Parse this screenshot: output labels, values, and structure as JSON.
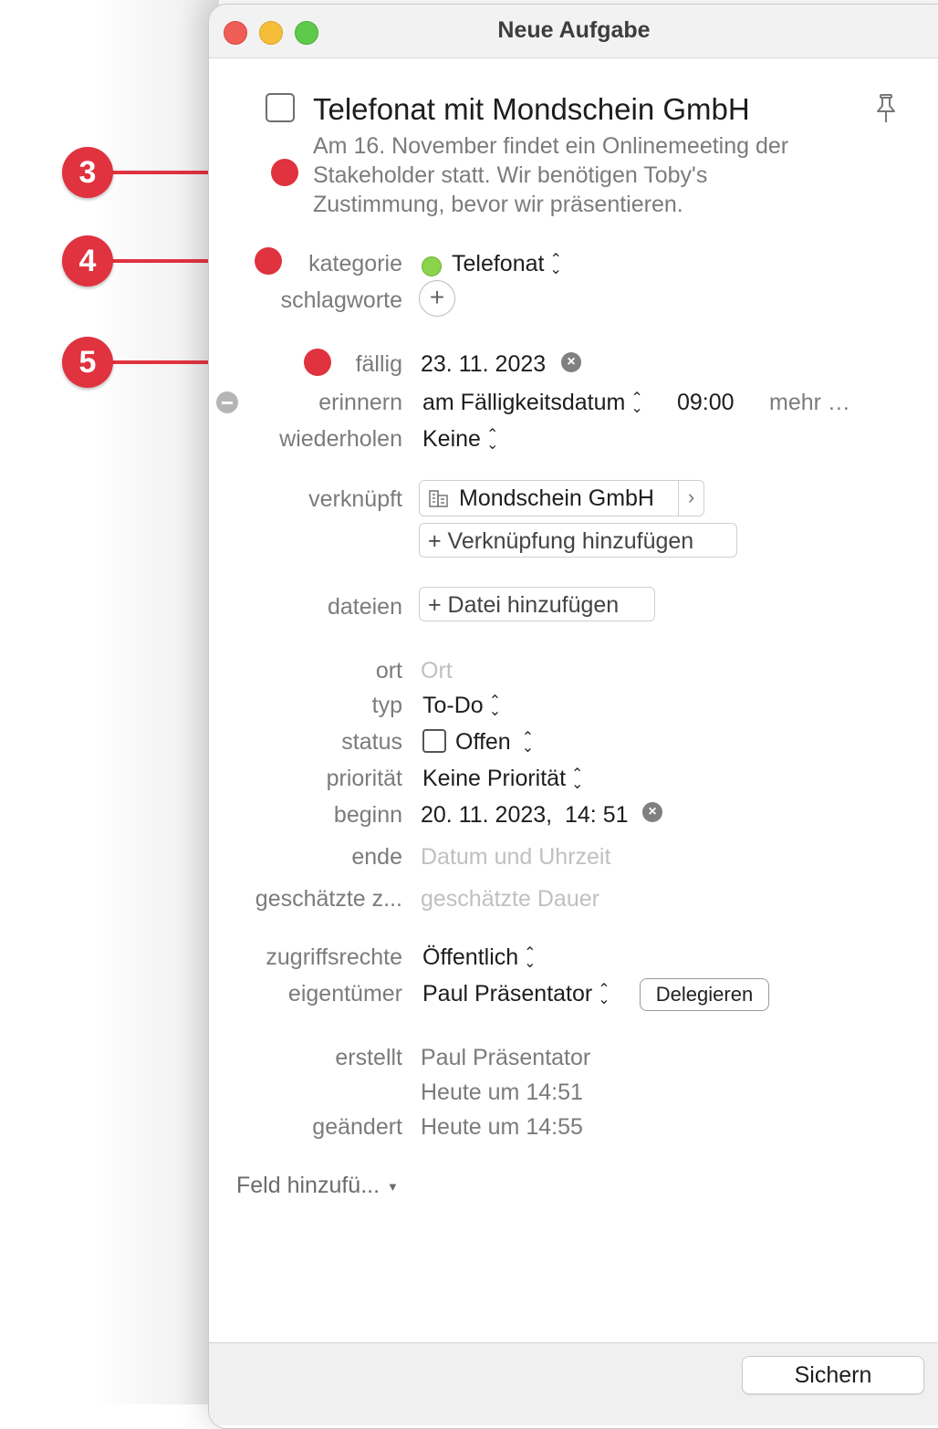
{
  "window": {
    "title": "Neue Aufgabe"
  },
  "task": {
    "title": "Telefonat mit Mondschein GmbH",
    "description_lines": [
      "Am 16. November findet ein Onlinemeeting der",
      "Stakeholder statt. Wir benötigen Toby's",
      "Zustimmung, bevor wir präsentieren."
    ]
  },
  "fields": {
    "kategorie": {
      "label": "kategorie",
      "value": "Telefonat",
      "dot_color": "#8ad34a"
    },
    "schlagworte": {
      "label": "schlagworte"
    },
    "faellig": {
      "label": "fällig",
      "value": "23. 11. 2023"
    },
    "erinnern": {
      "label": "erinnern",
      "value": "am Fälligkeitsdatum",
      "time": "09:00",
      "more": "mehr …"
    },
    "wiederholen": {
      "label": "wiederholen",
      "value": "Keine"
    },
    "verknuepft": {
      "label": "verknüpft",
      "link": "Mondschein GmbH",
      "add": "+ Verknüpfung hinzufügen"
    },
    "dateien": {
      "label": "dateien",
      "add": "+ Datei hinzufügen"
    },
    "ort": {
      "label": "ort",
      "placeholder": "Ort"
    },
    "typ": {
      "label": "typ",
      "value": "To-Do"
    },
    "status": {
      "label": "status",
      "value": "Offen"
    },
    "prioritaet": {
      "label": "priorität",
      "value": "Keine Priorität"
    },
    "beginn": {
      "label": "beginn",
      "value": "20. 11. 2023,  14: 51"
    },
    "ende": {
      "label": "ende",
      "placeholder": "Datum und Uhrzeit"
    },
    "dauer": {
      "label": "geschätzte z...",
      "placeholder": "geschätzte Dauer"
    },
    "zugriffsrechte": {
      "label": "zugriffsrechte",
      "value": "Öffentlich"
    },
    "eigentuemer": {
      "label": "eigentümer",
      "value": "Paul Präsentator",
      "button": "Delegieren"
    },
    "erstellt": {
      "label": "erstellt",
      "by": "Paul Präsentator",
      "when": "Heute um 14:51"
    },
    "geaendert": {
      "label": "geändert",
      "when": "Heute um 14:55"
    }
  },
  "add_field": "Feld hinzufü...",
  "footer": {
    "save": "Sichern"
  },
  "annotations": [
    "3",
    "4",
    "5"
  ],
  "colors": {
    "annotation": "#e0323f"
  }
}
